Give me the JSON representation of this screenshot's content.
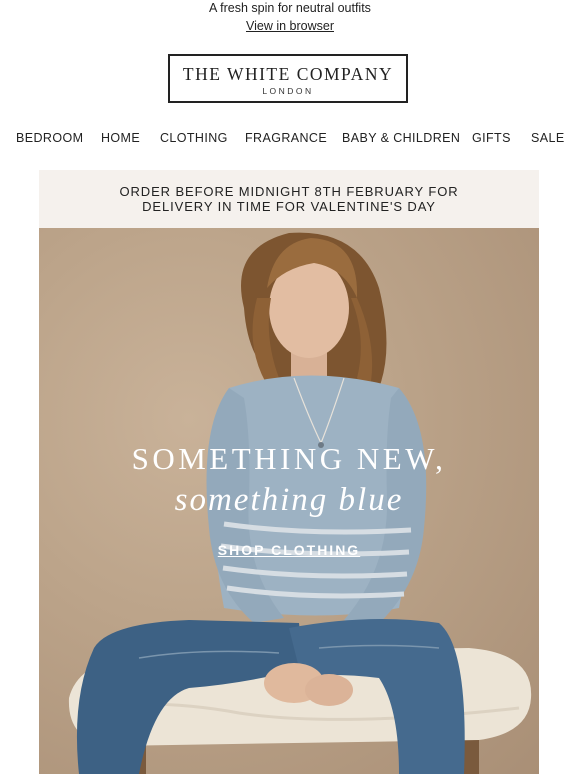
{
  "preheader": {
    "tagline": "A fresh spin for neutral outfits",
    "view_in_browser": "View in browser"
  },
  "logo": {
    "name": "THE WHITE COMPANY",
    "city": "LONDON"
  },
  "nav": {
    "items": [
      "BEDROOM",
      "HOME",
      "CLOTHING",
      "FRAGRANCE",
      "BABY & CHILDREN",
      "GIFTS",
      "SALE"
    ]
  },
  "banner": {
    "line1": "ORDER BEFORE MIDNIGHT 8TH FEBRUARY FOR",
    "line2": "DELIVERY IN TIME FOR VALENTINE'S DAY"
  },
  "hero": {
    "headline_line1": "SOMETHING NEW,",
    "headline_line2": "something blue",
    "cta_label": "SHOP CLOTHING",
    "image": "woman-in-blue-striped-sweater-and-jeans-seated-on-sheepskin-stool",
    "colors": {
      "background": "#bca48a",
      "sweater": "#9fb3c4",
      "jeans": "#3f6285",
      "hair": "#8a5f36",
      "text": "#ffffff"
    }
  },
  "colors": {
    "banner_bg": "#f5f1ed",
    "text": "#222222"
  }
}
